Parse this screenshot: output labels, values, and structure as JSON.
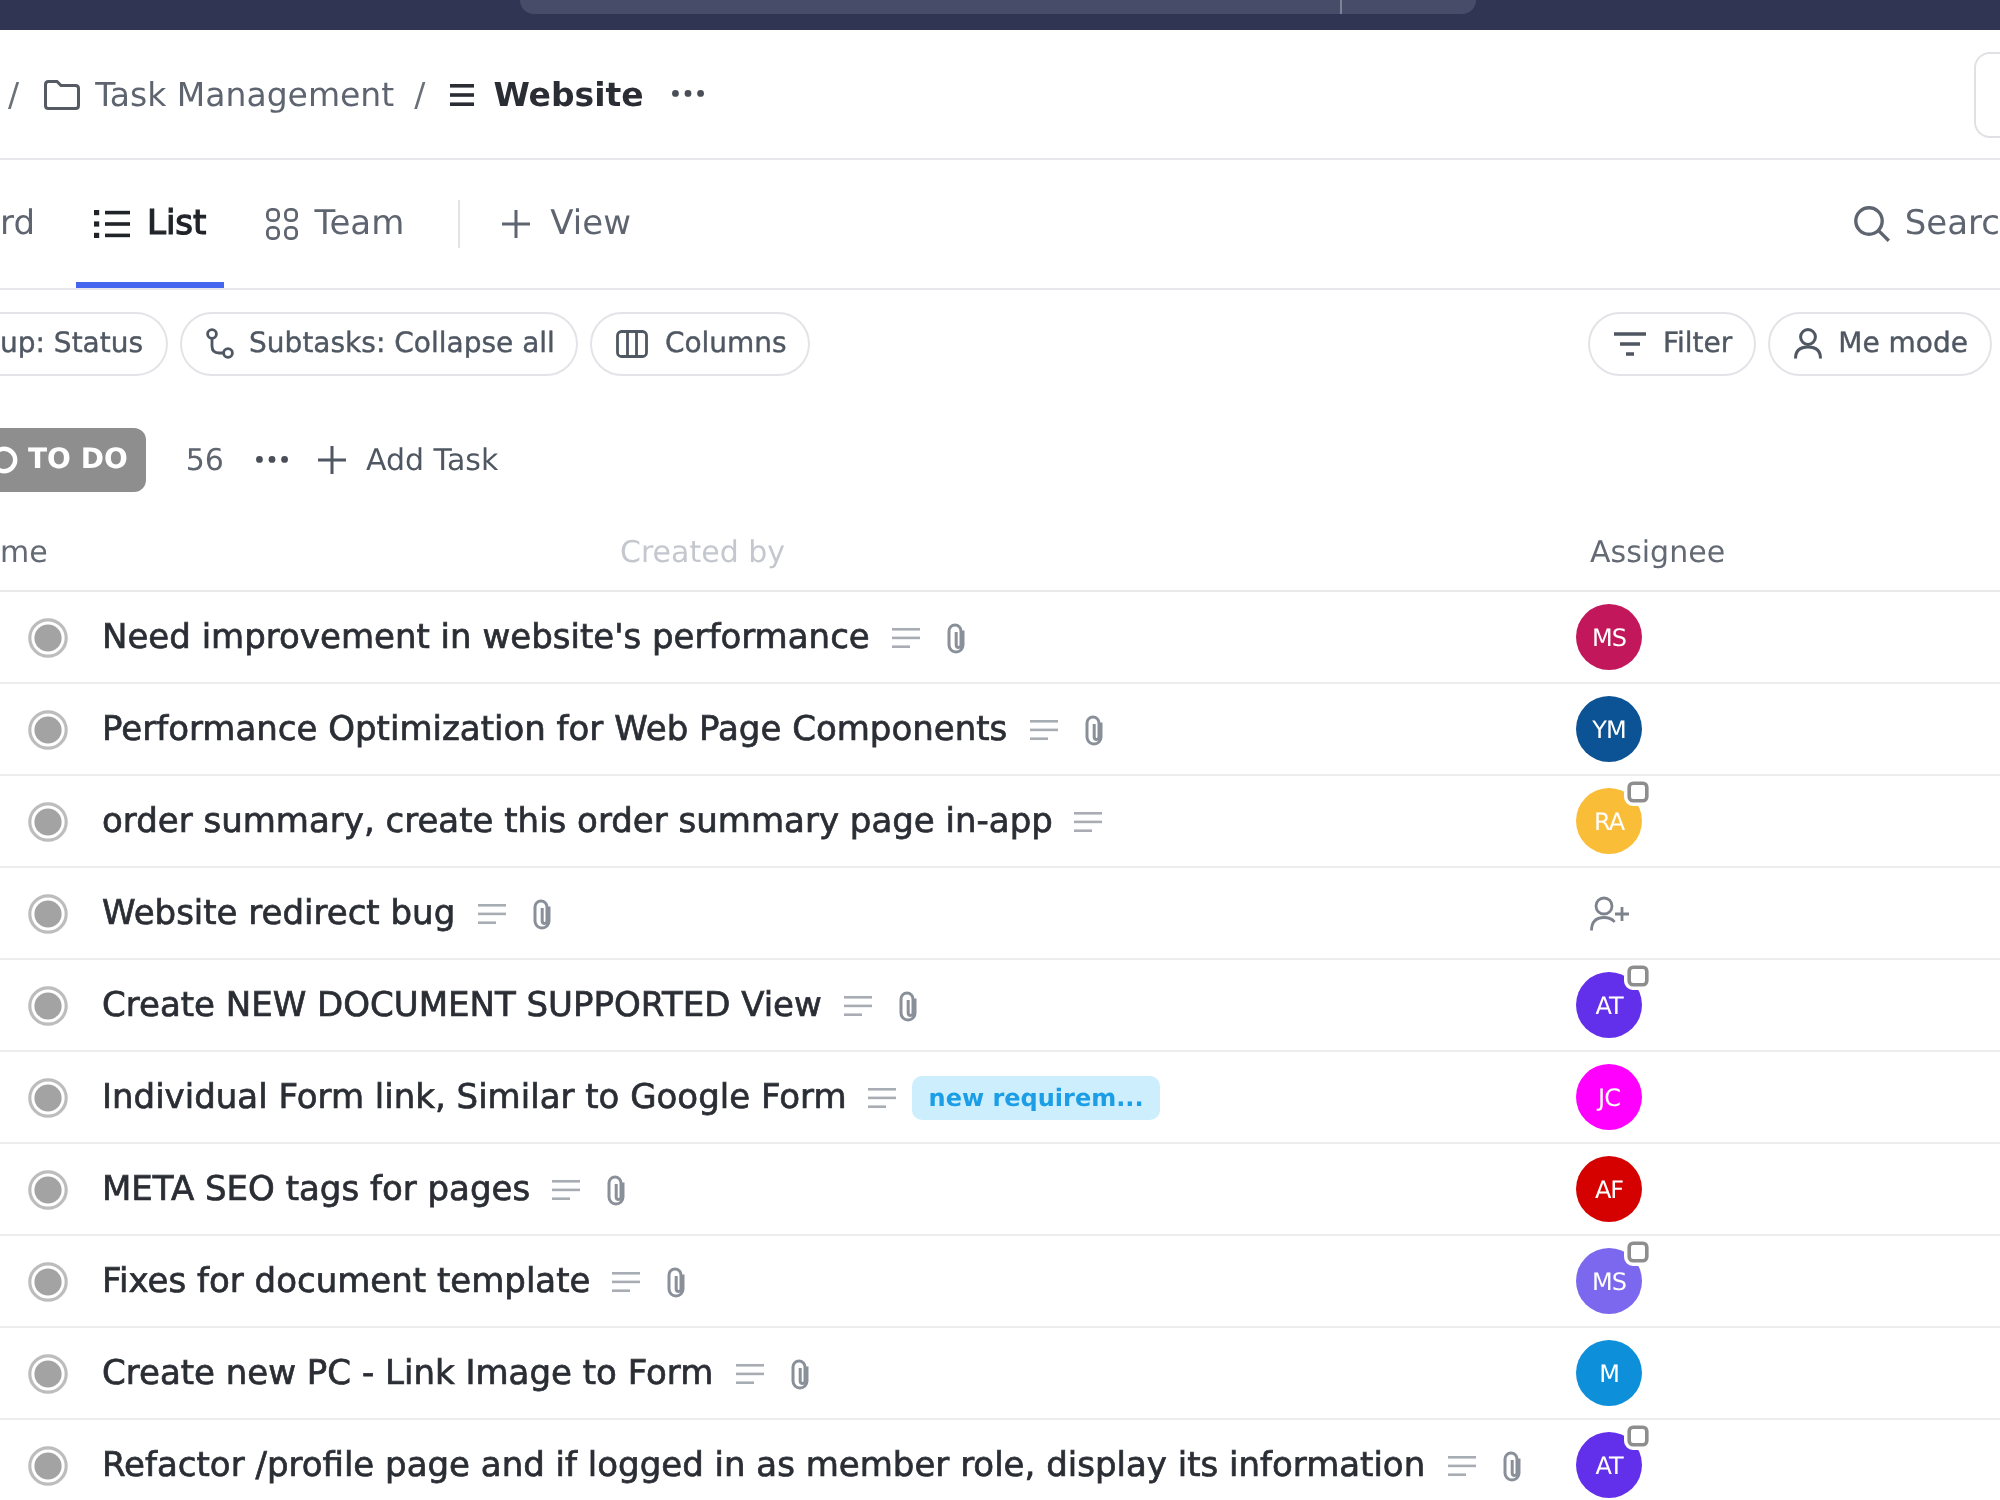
{
  "breadcrumb": {
    "items": [
      {
        "separator": "/",
        "kind": "folder",
        "label": "Task Management",
        "current": false
      },
      {
        "separator": "/",
        "kind": "list",
        "label": "Website",
        "current": true
      }
    ]
  },
  "view_tabs": [
    {
      "label": "rd",
      "kind": "text",
      "selected": false
    },
    {
      "label": "List",
      "kind": "list",
      "selected": true
    },
    {
      "label": "Team",
      "kind": "grid",
      "selected": false
    }
  ],
  "add_view": {
    "label": "View"
  },
  "search": {
    "label": "Searc"
  },
  "toolbar": {
    "left": [
      {
        "kind": "group",
        "label": "up: Status"
      },
      {
        "kind": "subtasks",
        "label": "Subtasks: Collapse all"
      },
      {
        "kind": "columns",
        "label": "Columns"
      }
    ],
    "right": [
      {
        "kind": "filter",
        "label": "Filter"
      },
      {
        "kind": "me",
        "label": "Me mode"
      }
    ]
  },
  "group": {
    "status": "TO DO",
    "count": "56",
    "add_task": "Add Task"
  },
  "columns": [
    {
      "label": "me",
      "disabled": false
    },
    {
      "label": "Created by",
      "disabled": true
    },
    {
      "label": "Assignee",
      "disabled": false
    }
  ],
  "rows": [
    {
      "name": "Need improvement in website's performance",
      "description": true,
      "attachment": true,
      "assignee": {
        "initials": "MS",
        "color": "#c2185b",
        "badge": false
      }
    },
    {
      "name": "Performance Optimization for Web Page Components",
      "description": true,
      "attachment": true,
      "assignee": {
        "initials": "YM",
        "color": "#0b5394",
        "badge": false
      }
    },
    {
      "name": "order summary, create this order summary page in-app",
      "description": true,
      "attachment": false,
      "assignee": {
        "initials": "RA",
        "color": "#f9bd38",
        "badge": true
      }
    },
    {
      "name": "Website redirect bug",
      "description": true,
      "attachment": true
    },
    {
      "name": "Create NEW DOCUMENT SUPPORTED View",
      "description": true,
      "attachment": true,
      "assignee": {
        "initials": "AT",
        "color": "#6230ea",
        "badge": true
      }
    },
    {
      "name": "Individual Form link, Similar to Google Form",
      "description": true,
      "attachment": false,
      "tag": "new requirem...",
      "assignee": {
        "initials": "JC",
        "color": "#ff00ff",
        "badge": false
      }
    },
    {
      "name": "META SEO tags for pages",
      "description": true,
      "attachment": true,
      "assignee": {
        "initials": "AF",
        "color": "#d50000",
        "badge": false
      }
    },
    {
      "name": "Fixes for document template",
      "description": true,
      "attachment": true,
      "assignee": {
        "initials": "MS",
        "color": "#7b68ee",
        "badge": true
      }
    },
    {
      "name": "Create new PC - Link Image to Form",
      "description": true,
      "attachment": true,
      "assignee": {
        "initials": "M",
        "color": "#0d8fd9",
        "badge": false
      }
    },
    {
      "name": "Refactor /profile page and if logged in as member role, display its information",
      "description": true,
      "attachment": true,
      "assignee": {
        "initials": "AT",
        "color": "#6230ea",
        "badge": true
      }
    }
  ]
}
